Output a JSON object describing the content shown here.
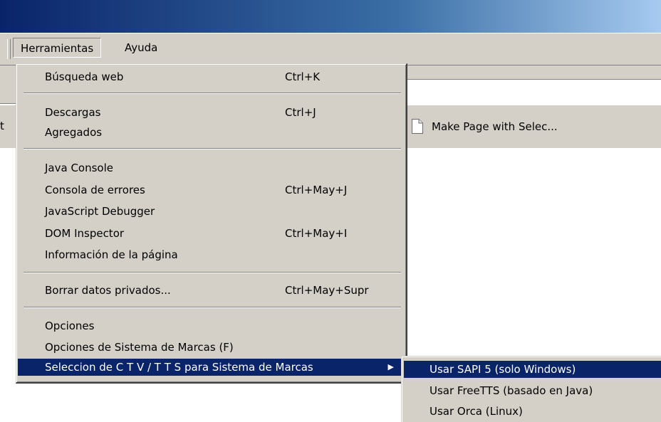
{
  "menubar": {
    "tools": "Herramientas",
    "help": "Ayuda"
  },
  "bookmarks_bar": {
    "left_fragment": "t",
    "make_page": "Make Page with Selec..."
  },
  "tools_menu": {
    "web_search": {
      "label": "Búsqueda web",
      "accel": "Ctrl+K"
    },
    "downloads": {
      "label": "Descargas",
      "accel": "Ctrl+J"
    },
    "addons": {
      "label": "Agregados"
    },
    "java_console": {
      "label": "Java Console"
    },
    "error_console": {
      "label": "Consola de errores",
      "accel": "Ctrl+May+J"
    },
    "js_debugger": {
      "label": "JavaScript Debugger"
    },
    "dom_inspector": {
      "label": "DOM Inspector",
      "accel": "Ctrl+May+I"
    },
    "page_info": {
      "label": "Información de la página"
    },
    "clear_private": {
      "label": "Borrar datos privados...",
      "accel": "Ctrl+May+Supr"
    },
    "options": {
      "label": "Opciones"
    },
    "bookmark_options": {
      "label": "Opciones de Sistema de Marcas (F)"
    },
    "tts_select": {
      "label": "Seleccion de C T V / T T S para Sistema de Marcas"
    }
  },
  "tts_submenu": {
    "sapi": "Usar SAPI 5 (solo Windows)",
    "freetts": "Usar FreeTTS (basado en Java)",
    "orca": "Usar Orca (Linux)"
  },
  "icons": {
    "submenu_arrow": "triangle-right",
    "page": "blank-page-icon"
  },
  "colors": {
    "highlight": "#0a246a",
    "menu_bg": "#d4d0c8"
  }
}
